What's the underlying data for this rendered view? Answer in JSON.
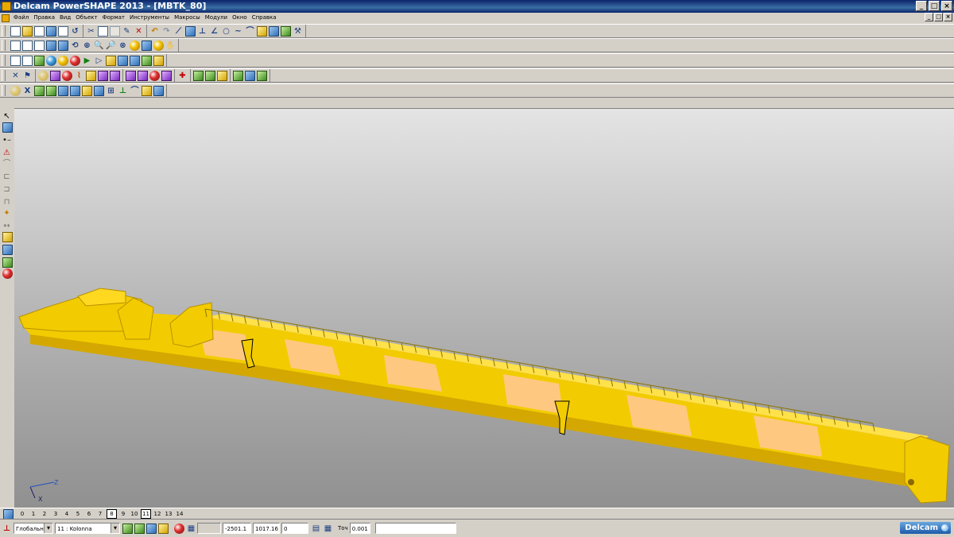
{
  "window": {
    "title": "Delcam PowerSHAPE 2013 - [MBTK_80]",
    "minimize": "_",
    "maximize": "□",
    "close": "×"
  },
  "menu": [
    "Файл",
    "Правка",
    "Вид",
    "Объект",
    "Формат",
    "Инструменты",
    "Макросы",
    "Модули",
    "Окно",
    "Справка"
  ],
  "levels": {
    "items": [
      "0",
      "1",
      "2",
      "3",
      "4",
      "5",
      "6",
      "7",
      "8",
      "9",
      "10",
      "11",
      "12",
      "13",
      "14"
    ],
    "active": [
      "8",
      "11"
    ]
  },
  "status": {
    "workplane": "Глобальна",
    "level_select": "11 : Kolonna",
    "coord_x": "-2501.1",
    "coord_y": "1017.16",
    "coord_z": "0",
    "tolerance_label": "Точ",
    "tolerance_value": "0.001",
    "brand": "Delcam"
  },
  "triad": {
    "x_label": "X",
    "z_label": "Z"
  },
  "colors": {
    "model_yellow": "#f2cc00",
    "model_peach": "#ffc880",
    "titlebar": "#0a246a"
  }
}
